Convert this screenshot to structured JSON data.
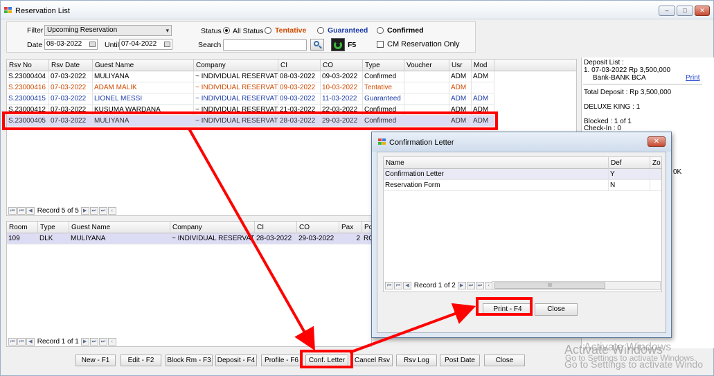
{
  "window": {
    "title": "Reservation List",
    "controls": {
      "minimize": "‒",
      "maximize": "□",
      "close": "✕"
    }
  },
  "filter": {
    "filter_label": "Filter",
    "filter_value": "Upcoming Reservation",
    "date_label": "Date",
    "date_from": "08-03-2022",
    "until_label": "Until",
    "date_until": "07-04-2022",
    "status_label": "Status",
    "status_options": [
      {
        "label": "All Status",
        "color": "#000000",
        "selected": true
      },
      {
        "label": "Tentative",
        "color": "#d04a00",
        "selected": false
      },
      {
        "label": "Guaranteed",
        "color": "#1a3aa8",
        "selected": false
      },
      {
        "label": "Confirmed",
        "color": "#000000",
        "selected": false
      }
    ],
    "search_label": "Search",
    "search_value": "",
    "refresh_key": "F5",
    "cm_only_label": "CM Reservation Only"
  },
  "reservations": {
    "columns": [
      "Rsv No",
      "Rsv Date",
      "Guest Name",
      "Company",
      "CI",
      "CO",
      "Type",
      "Voucher",
      "Usr",
      "Mod"
    ],
    "rows": [
      [
        "S.23000404",
        "07-03-2022",
        "MULIYANA",
        "~ INDIVIDUAL RESERVATI...",
        "08-03-2022",
        "09-03-2022",
        "Confirmed",
        "",
        "ADM",
        "ADM"
      ],
      [
        "S.23000416",
        "07-03-2022",
        "ADAM MALIK",
        "~ INDIVIDUAL RESERVATI...",
        "09-03-2022",
        "10-03-2022",
        "Tentative",
        "",
        "ADM",
        ""
      ],
      [
        "S.23000415",
        "07-03-2022",
        "LIONEL MESSI",
        "~ INDIVIDUAL RESERVATI...",
        "09-03-2022",
        "11-03-2022",
        "Guaranteed",
        "",
        "ADM",
        "ADM"
      ],
      [
        "S.23000412",
        "07-03-2022",
        "KUSUMA WARDANA",
        "~ INDIVIDUAL RESERVATI...",
        "21-03-2022",
        "22-03-2022",
        "Confirmed",
        "",
        "ADM",
        "ADM"
      ],
      [
        "S.23000405",
        "07-03-2022",
        "MULIYANA",
        "~ INDIVIDUAL RESERVATI...",
        "28-03-2022",
        "29-03-2022",
        "Confirmed",
        "",
        "ADM",
        "ADM"
      ]
    ],
    "row_colors": [
      "#000000",
      "#d04a00",
      "#1a3aa8",
      "#000000",
      "#333333"
    ],
    "record_text": "Record 5 of 5"
  },
  "rooms": {
    "columns": [
      "Room",
      "Type",
      "Guest Name",
      "Company",
      "CI",
      "CO",
      "Pax",
      "Pc"
    ],
    "rows": [
      [
        "109",
        "DLK",
        "MULIYANA",
        "~ INDIVIDUAL RESERVATI...",
        "28-03-2022",
        "29-03-2022",
        "2",
        "RO"
      ]
    ],
    "record_text": "Record 1 of 1"
  },
  "deposit": {
    "title": "Deposit List :",
    "entry": "1. 07-03-2022  Rp 3,500,000",
    "bank": "Bank-BANK BCA",
    "print": "Print",
    "total": "Total Deposit : Rp 3,500,000",
    "room_type": "DELUXE KING : 1",
    "blocked": "Blocked : 1 of 1",
    "checkin": "Check-In : 0",
    "partial": "0K"
  },
  "toolbar": [
    "New - F1",
    "Edit - F2",
    "Block Rm - F3",
    "Deposit - F4",
    "Profile  - F6",
    "Conf. Letter",
    "Cancel Rsv",
    "Rsv Log",
    "Post Date",
    "Close"
  ],
  "dialog": {
    "title": "Confirmation Letter",
    "close_glyph": "✕",
    "columns": [
      "Name",
      "Def",
      "Zo"
    ],
    "rows": [
      [
        "Confirmation Letter",
        "Y",
        ""
      ],
      [
        "Reservation Form",
        "N",
        ""
      ]
    ],
    "record_text": "Record 1 of 2",
    "scroll_grip": "III",
    "print_button": "Print - F4",
    "close_button": "Close"
  },
  "watermark": {
    "line1": "Activate Windows",
    "line2": "Go to Settings to activate Windows.",
    "line3": "Go to Settings to activate Windo"
  },
  "icons": {
    "nav_first": "⏮",
    "nav_prev": "◀",
    "nav_next": "▶",
    "nav_last": "⏭",
    "dropdown": "▾",
    "scroll_left": "‹",
    "scroll_right": "›"
  },
  "colors": {
    "highlight": "#ff0000",
    "selected_row": "#dcdcf4",
    "tentative": "#d04a00",
    "guaranteed": "#1a3aa8"
  }
}
